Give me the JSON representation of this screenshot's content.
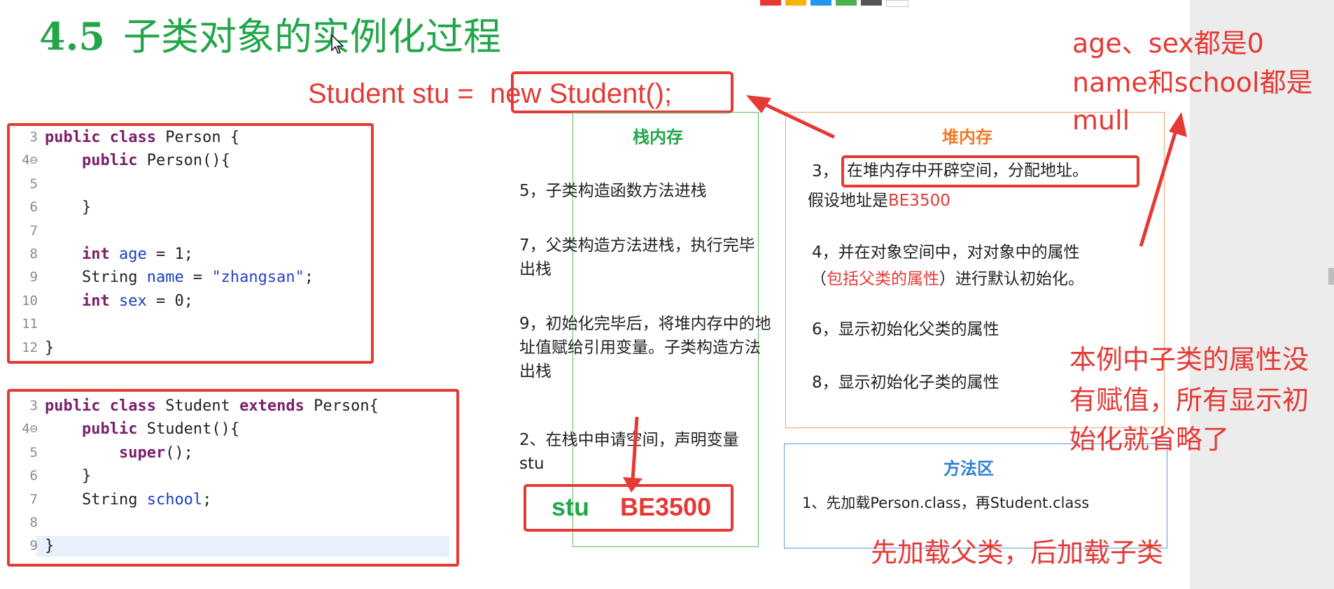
{
  "colors": {
    "title_green": "#22a64a",
    "annotation_red": "#e53935",
    "stack_border": "#5cb85c",
    "heap_border": "#f0a06a",
    "method_border": "#5b9bd5",
    "heap_header": "#f07a2a",
    "method_header": "#2f7fd0"
  },
  "toolbar_swatches": [
    "#e53935",
    "#f4b400",
    "#2196f3",
    "#4caf50",
    "#555555",
    "#ffffff"
  ],
  "title": {
    "number": "4.5",
    "text": "子类对象的实例化过程"
  },
  "statement": {
    "prefix": "Student stu =",
    "highlighted": "new Student();"
  },
  "person_code": [
    {
      "ln": "3",
      "code": [
        {
          "t": "public class ",
          "c": "kw"
        },
        {
          "t": "Person {",
          "c": ""
        }
      ]
    },
    {
      "ln": "4⊖",
      "code": [
        {
          "t": "    public ",
          "c": "kw"
        },
        {
          "t": "Person(){",
          "c": ""
        }
      ]
    },
    {
      "ln": "5",
      "code": []
    },
    {
      "ln": "6",
      "code": [
        {
          "t": "    }",
          "c": ""
        }
      ]
    },
    {
      "ln": "7",
      "code": []
    },
    {
      "ln": "8",
      "code": [
        {
          "t": "    int ",
          "c": "kw"
        },
        {
          "t": "age",
          "c": "fld"
        },
        {
          "t": " = 1;",
          "c": ""
        }
      ]
    },
    {
      "ln": "9",
      "code": [
        {
          "t": "    String ",
          "c": ""
        },
        {
          "t": "name",
          "c": "fld"
        },
        {
          "t": " = ",
          "c": ""
        },
        {
          "t": "\"zhangsan\"",
          "c": "str"
        },
        {
          "t": ";",
          "c": ""
        }
      ]
    },
    {
      "ln": "10",
      "code": [
        {
          "t": "    int ",
          "c": "kw"
        },
        {
          "t": "sex",
          "c": "fld"
        },
        {
          "t": " = 0;",
          "c": ""
        }
      ]
    },
    {
      "ln": "11",
      "code": []
    },
    {
      "ln": "12",
      "code": [
        {
          "t": "}",
          "c": ""
        }
      ]
    }
  ],
  "student_code": [
    {
      "ln": "3",
      "code": [
        {
          "t": "public class ",
          "c": "kw"
        },
        {
          "t": "Student ",
          "c": ""
        },
        {
          "t": "extends ",
          "c": "kw"
        },
        {
          "t": "Person{",
          "c": ""
        }
      ]
    },
    {
      "ln": "4⊖",
      "code": [
        {
          "t": "    public ",
          "c": "kw"
        },
        {
          "t": "Student(){",
          "c": ""
        }
      ]
    },
    {
      "ln": "5",
      "code": [
        {
          "t": "        super",
          "c": "kw"
        },
        {
          "t": "();",
          "c": ""
        }
      ]
    },
    {
      "ln": "6",
      "code": [
        {
          "t": "    }",
          "c": ""
        }
      ]
    },
    {
      "ln": "7",
      "code": [
        {
          "t": "    String ",
          "c": ""
        },
        {
          "t": "school",
          "c": "fld"
        },
        {
          "t": ";",
          "c": ""
        }
      ]
    },
    {
      "ln": "8",
      "code": []
    },
    {
      "ln": "9",
      "code": [
        {
          "t": "}",
          "c": ""
        }
      ]
    }
  ],
  "stack": {
    "header": "栈内存",
    "note_5": "5，子类构造函数方法进栈",
    "note_7": "7，父类构造方法进栈，执行完毕出栈",
    "note_9": "9，初始化完毕后，将堆内存中的地址值赋给引用变量。子类构造方法出栈",
    "note_2": "2、在栈中申请空间，声明变量stu",
    "var_name": "stu",
    "var_value": "BE3500"
  },
  "heap": {
    "header": "堆内存",
    "step3_num": "3，",
    "step3_text": "在堆内存中开辟空间，分配地址。",
    "step3_line2_prefix": "假设地址是",
    "step3_line2_addr": "BE3500",
    "step4_line1": "4，并在对象空间中，对对象中的属性",
    "step4_open": "（",
    "step4_red": "包括父类的属性",
    "step4_close": "）进行默认初始化。",
    "step6": "6，显示初始化父类的属性",
    "step8": "8，显示初始化子类的属性"
  },
  "method_area": {
    "header": "方法区",
    "step1": "1、先加载Person.class，再Student.class"
  },
  "annotations": {
    "top_right_1": "age、sex都是0",
    "top_right_2": "name和school都是",
    "top_right_3": "mull",
    "mid_right_1": "本例中子类的属性没",
    "mid_right_2": "有赋值，所有显示初",
    "mid_right_3": "始化就省略了",
    "bottom": "先加载父类，后加载子类"
  }
}
